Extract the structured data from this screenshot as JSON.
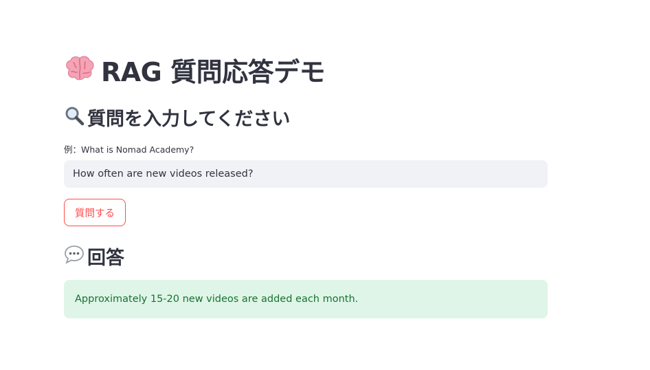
{
  "app": {
    "title": "RAG 質問応答デモ",
    "title_icon": "brain-icon"
  },
  "question_section": {
    "heading": "質問を入力してください",
    "heading_icon": "magnifier-icon",
    "input_label": "例：What is Nomad Academy?",
    "input_value": "How often are new videos released?",
    "submit_label": "質問する"
  },
  "answer_section": {
    "heading": "回答",
    "heading_icon": "speech-bubble-icon",
    "answer_text": "Approximately 15-20 new videos are added each month."
  },
  "colors": {
    "primary": "#ff4b4b",
    "text": "#31333f",
    "input_bg": "#f0f2f6",
    "success_bg": "#dff5e7",
    "success_text": "#177233"
  }
}
